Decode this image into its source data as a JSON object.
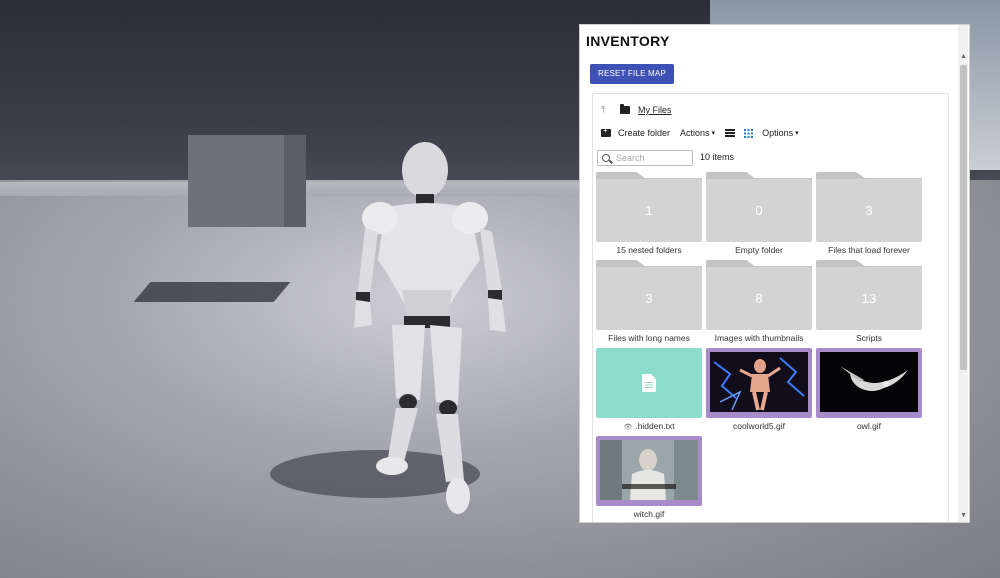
{
  "colors": {
    "primary_button": "#3f51b5",
    "folder": "#d3d3d3",
    "text_file": "#8ddcc9",
    "image_file": "#a88bc9"
  },
  "panel": {
    "title": "INVENTORY",
    "reset_button": "RESET FILE MAP"
  },
  "breadcrumb": {
    "up_icon": "arrow-up-icon",
    "folder_icon": "folder-icon",
    "current": "My Files"
  },
  "toolbar": {
    "create_folder": "Create folder",
    "actions": "Actions",
    "options": "Options",
    "view_mode": "grid"
  },
  "search": {
    "placeholder": "Search",
    "value": "",
    "item_count": "10 items"
  },
  "folders": [
    {
      "name": "15 nested folders",
      "count": "1"
    },
    {
      "name": "Empty folder",
      "count": "0"
    },
    {
      "name": "Files that load forever",
      "count": "3"
    },
    {
      "name": "Files with long names",
      "count": "3"
    },
    {
      "name": "Images with thumbnails",
      "count": "8"
    },
    {
      "name": "Scripts",
      "count": "13"
    }
  ],
  "files": [
    {
      "name": ".hidden.txt",
      "type": "text",
      "hidden": true
    },
    {
      "name": "coolworld5.gif",
      "type": "image"
    },
    {
      "name": "owl.gif",
      "type": "image"
    },
    {
      "name": "witch.gif",
      "type": "image"
    }
  ]
}
